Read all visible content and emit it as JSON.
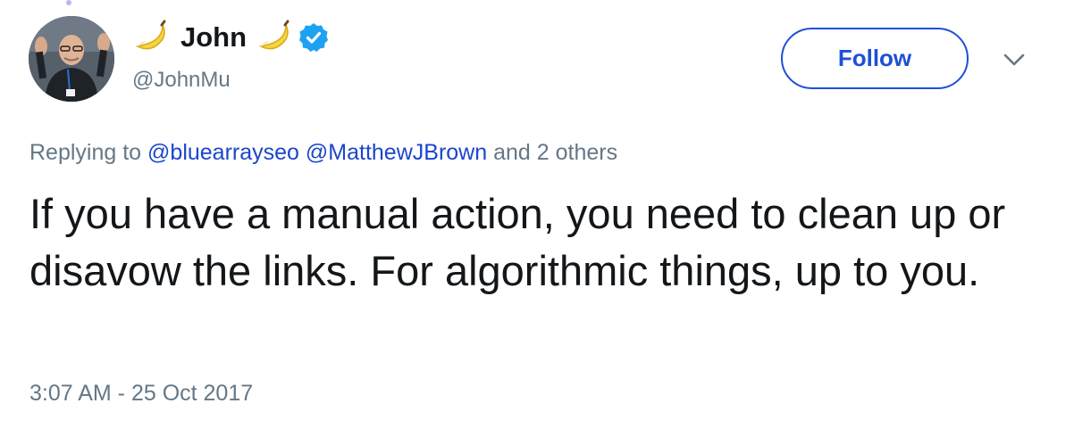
{
  "author": {
    "display_name": "John",
    "handle": "@JohnMu",
    "verified": true,
    "name_emoji": "banana-emoji"
  },
  "header": {
    "follow_label": "Follow",
    "more_icon": "chevron-down-icon"
  },
  "reply_context": {
    "prefix": "Replying to",
    "mentions": [
      "@bluearrayseo",
      "@MatthewJBrown"
    ],
    "suffix": "and 2 others"
  },
  "tweet": {
    "text": "If you have a manual action, you need to clean up or disavow the links. For algorithmic things, up to you.",
    "timestamp": "3:07 AM - 25 Oct 2017"
  },
  "colors": {
    "link": "#1b46cc",
    "follow": "#1d4fd8",
    "muted": "#657786",
    "verified": "#1da1f2",
    "text": "#14171a"
  }
}
